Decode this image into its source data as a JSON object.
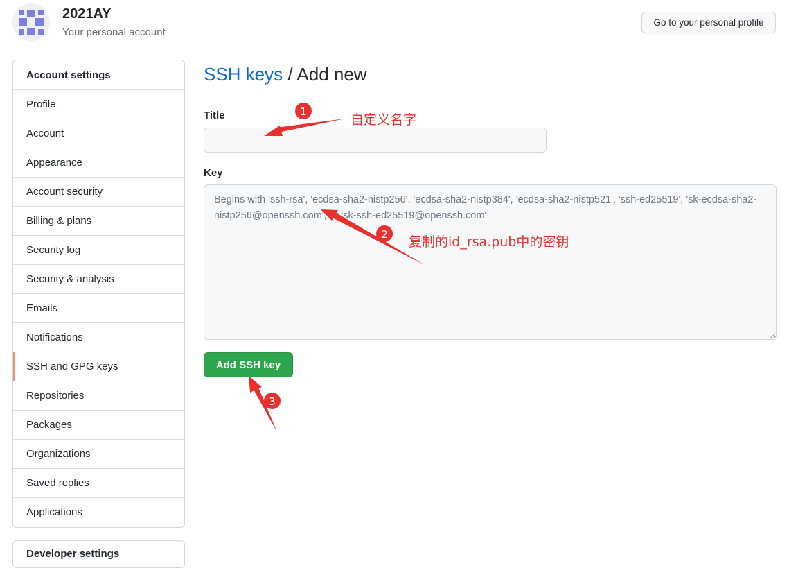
{
  "header": {
    "username": "2021AY",
    "account_type": "Your personal account",
    "profile_button": "Go to your personal profile"
  },
  "sidebar": {
    "heading": "Account settings",
    "items": [
      {
        "label": "Profile"
      },
      {
        "label": "Account"
      },
      {
        "label": "Appearance"
      },
      {
        "label": "Account security"
      },
      {
        "label": "Billing & plans"
      },
      {
        "label": "Security log"
      },
      {
        "label": "Security & analysis"
      },
      {
        "label": "Emails"
      },
      {
        "label": "Notifications"
      },
      {
        "label": "SSH and GPG keys",
        "selected": true
      },
      {
        "label": "Repositories"
      },
      {
        "label": "Packages"
      },
      {
        "label": "Organizations"
      },
      {
        "label": "Saved replies"
      },
      {
        "label": "Applications"
      }
    ],
    "second_heading": "Developer settings"
  },
  "main": {
    "breadcrumb_link": "SSH keys",
    "breadcrumb_separator": " / ",
    "breadcrumb_current": "Add new",
    "title_label": "Title",
    "title_value": "",
    "key_label": "Key",
    "key_placeholder": "Begins with 'ssh-rsa', 'ecdsa-sha2-nistp256', 'ecdsa-sha2-nistp384', 'ecdsa-sha2-nistp521', 'ssh-ed25519', 'sk-ecdsa-sha2-nistp256@openssh.com', or 'sk-ssh-ed25519@openssh.com'",
    "submit_button": "Add SSH key"
  },
  "annotations": [
    {
      "number": "1",
      "text": "自定义名字"
    },
    {
      "number": "2",
      "text": "复制的id_rsa.pub中的密钥"
    },
    {
      "number": "3",
      "text": ""
    }
  ],
  "colors": {
    "link": "#0969da",
    "primary_button": "#2da44e",
    "selected_indicator": "#fd8c73",
    "annotation_red": "#e8312e"
  }
}
